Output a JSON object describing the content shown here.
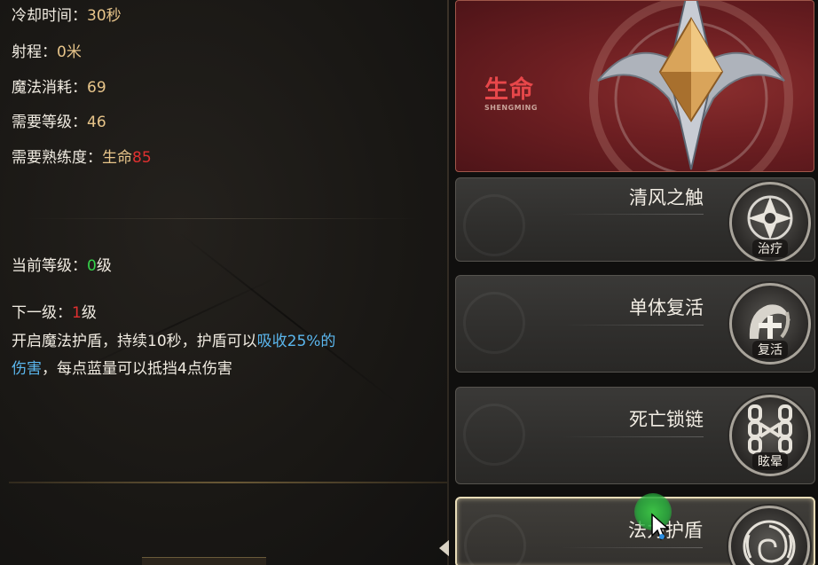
{
  "info": {
    "cooldown_label": "冷却时间：",
    "cooldown_value": "30秒",
    "range_label": "射程：",
    "range_value": "0米",
    "mana_label": "魔法消耗：",
    "mana_value": "69",
    "level_req_label": "需要等级：",
    "level_req_value": "46",
    "proficiency_label": "需要熟练度：",
    "proficiency_school": "生命",
    "proficiency_value": "85",
    "current_level_label": "当前等级：",
    "current_level_value": "0",
    "current_level_unit": "级",
    "next_level_label": "下一级：",
    "next_level_value": "1",
    "next_level_unit": "级",
    "desc_part1": "开启魔法护盾，持续10秒，护盾可以",
    "desc_highlight_a": "吸收25%的",
    "desc_highlight_b": "伤害",
    "desc_part2": "，每点蓝量可以抵挡4点伤害"
  },
  "school": {
    "title": "生命",
    "subtitle": "SHENGMING",
    "color": "#e7474a"
  },
  "skills": [
    {
      "name": "清风之触",
      "tag": "治疗",
      "icon": "shuriken-icon"
    },
    {
      "name": "单体复活",
      "tag": "复活",
      "icon": "resurrect-icon"
    },
    {
      "name": "死亡锁链",
      "tag": "眩晕",
      "icon": "chain-icon"
    },
    {
      "name": "法力护盾",
      "tag": "",
      "icon": "shield-swirl-icon",
      "selected": true
    }
  ],
  "colors": {
    "gold": "#e8c58a",
    "red": "#e03030",
    "green": "#35d24a",
    "blue": "#5bb7ee"
  }
}
